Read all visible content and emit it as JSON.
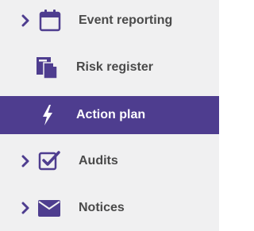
{
  "colors": {
    "sidebar_bg": "#f0f0f1",
    "accent": "#4e3d8f",
    "text": "#4a4a4a",
    "active_text": "#ffffff"
  },
  "menu": {
    "items": [
      {
        "label": "Event reporting",
        "icon": "calendar-icon",
        "expandable": true,
        "active": false
      },
      {
        "label": "Risk register",
        "icon": "documents-icon",
        "expandable": false,
        "active": false
      },
      {
        "label": "Action plan",
        "icon": "lightning-bolt-icon",
        "expandable": false,
        "active": true
      },
      {
        "label": "Audits",
        "icon": "checkbox-icon",
        "expandable": true,
        "active": false
      },
      {
        "label": "Notices",
        "icon": "envelope-icon",
        "expandable": true,
        "active": false
      }
    ]
  }
}
